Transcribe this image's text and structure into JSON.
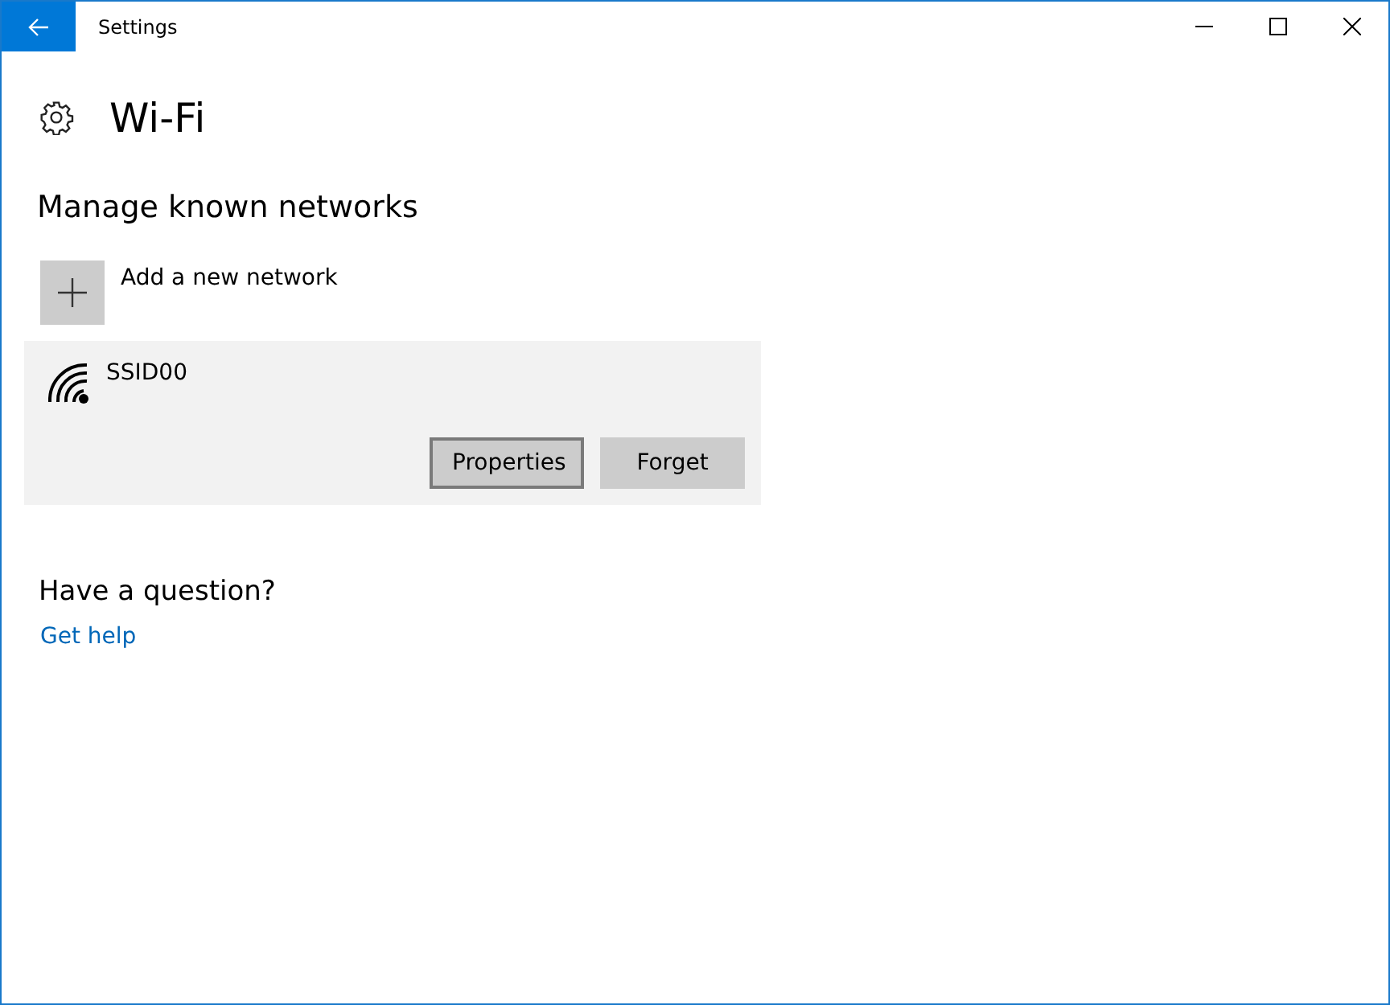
{
  "window": {
    "title": "Settings"
  },
  "page": {
    "title": "Wi-Fi"
  },
  "section": {
    "title": "Manage known networks",
    "add_label": "Add a new network"
  },
  "networks": [
    {
      "name": "SSID00",
      "expanded": true,
      "buttons": [
        {
          "label": "Properties",
          "focused": true
        },
        {
          "label": "Forget",
          "focused": false
        }
      ]
    }
  ],
  "help": {
    "title": "Have a question?",
    "link": "Get help"
  }
}
